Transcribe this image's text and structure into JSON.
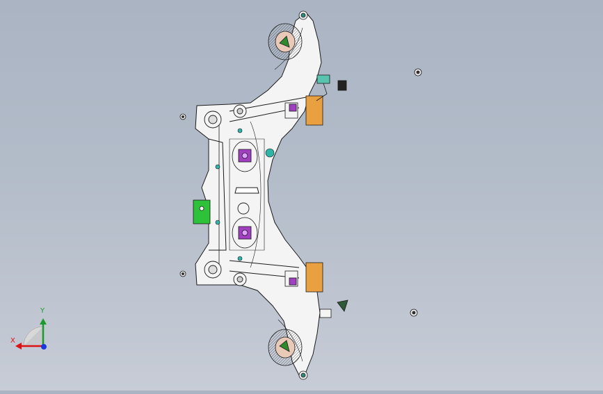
{
  "viewport": {
    "background_top": "#aab4c3",
    "background_bottom": "#c7ccd6",
    "model_stroke": "#1a1a1a",
    "model_fill": "#f4f4f4",
    "accent_purple": "#a040c0",
    "accent_green": "#2ec23a",
    "accent_orange": "#e8a040",
    "accent_teal": "#2fb5a8"
  },
  "triad": {
    "x_label": "X",
    "y_label": "Y",
    "x_color": "#d11",
    "y_color": "#1a9a2a",
    "z_color": "#1a3adf"
  }
}
